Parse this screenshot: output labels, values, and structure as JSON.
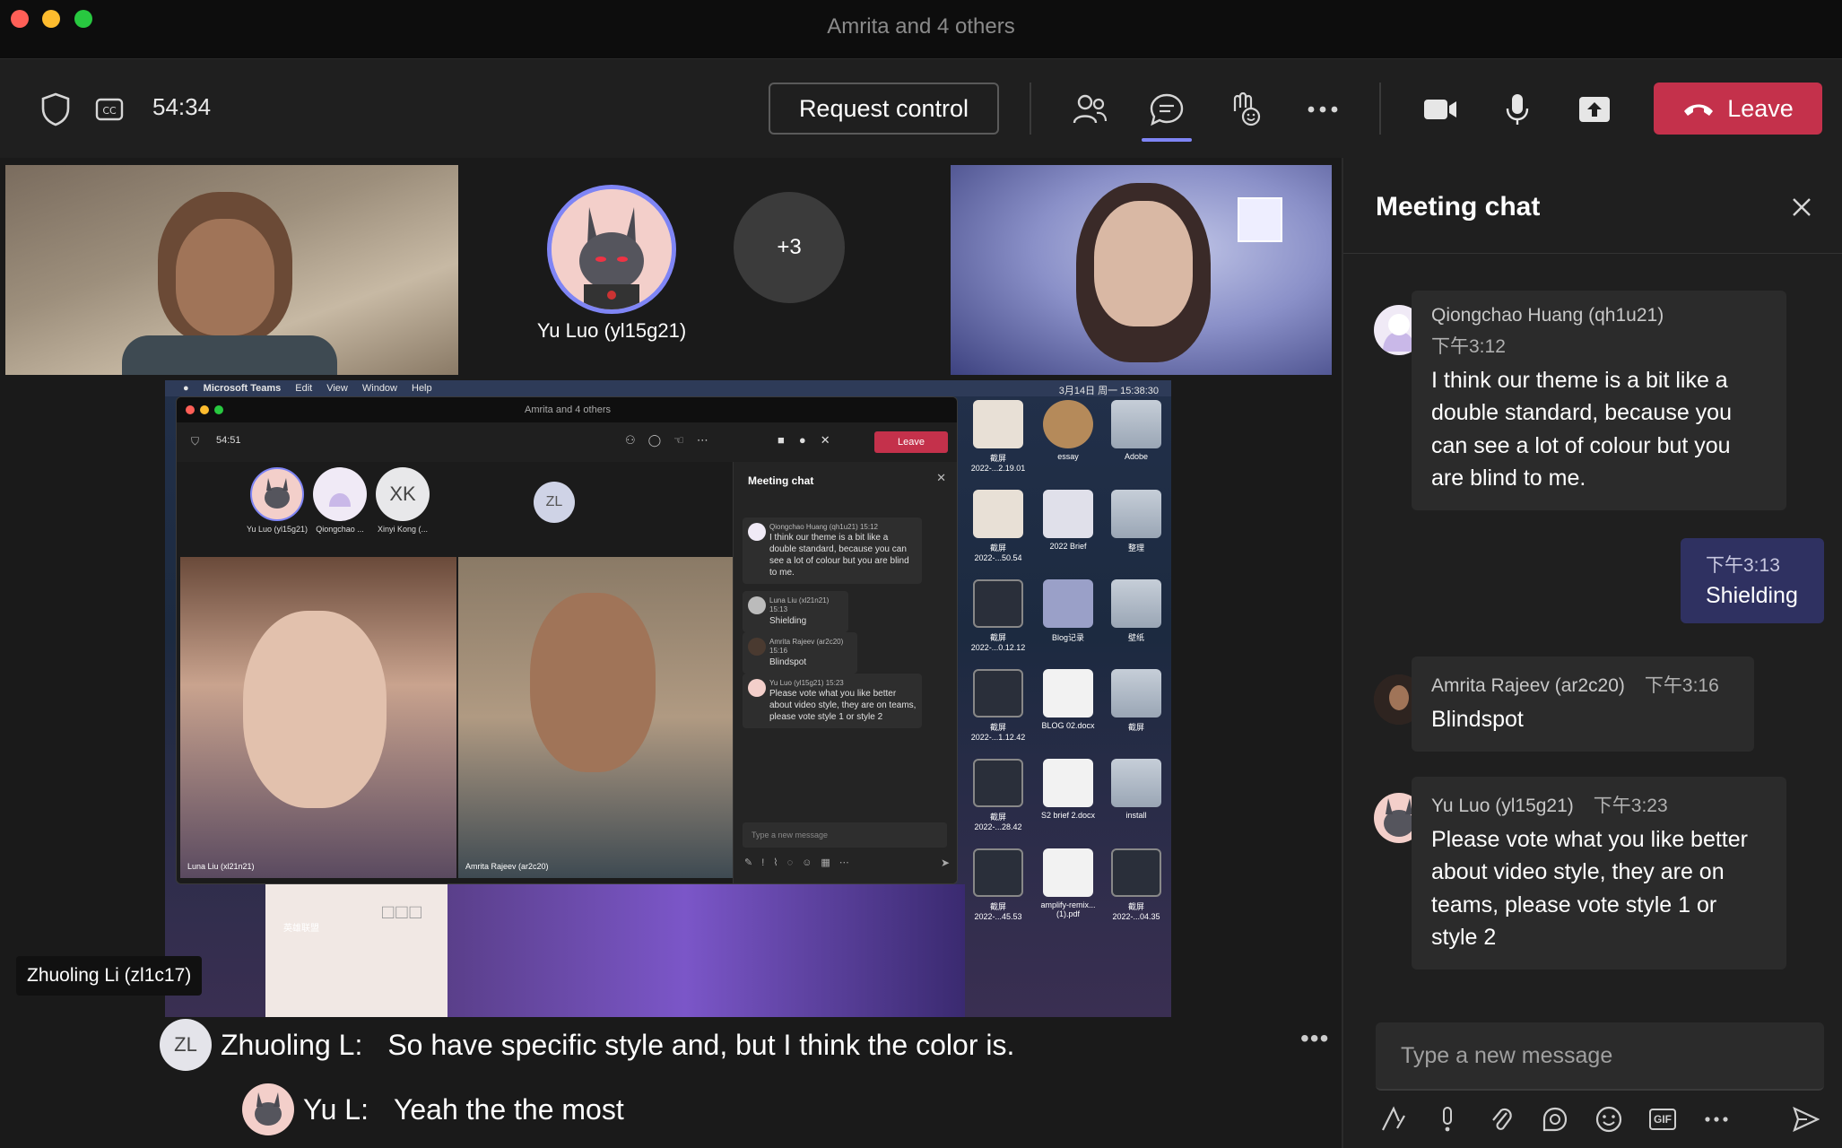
{
  "window": {
    "title": "Amrita and 4 others"
  },
  "toolbar": {
    "timer": "54:34",
    "request_control_label": "Request control",
    "leave_label": "Leave",
    "icons": [
      "shield-icon",
      "captions-icon",
      "people-icon",
      "chat-icon",
      "reactions-icon",
      "more-icon",
      "camera-icon",
      "mic-icon",
      "share-icon",
      "phone-icon"
    ]
  },
  "stage": {
    "avatar_name": "Yu Luo (yl15g21)",
    "overflow_count": "+3",
    "speaker_tag": "Zhuoling Li (zl1c17)"
  },
  "shared_screen": {
    "menubar": {
      "app": "Microsoft Teams",
      "items": [
        "Edit",
        "View",
        "Window",
        "Help"
      ],
      "clock": "3月14日 周一 15:38:30"
    },
    "window_title": "Amrita and 4 others",
    "timer": "54:51",
    "leave_label": "Leave",
    "participants": [
      {
        "name": "Yu Luo (yl15g21)"
      },
      {
        "name": "Qiongchao ..."
      },
      {
        "initials": "XK",
        "name": "Xinyi Kong (..."
      }
    ],
    "zl_initials": "ZL",
    "video_names": [
      "Luna Liu (xl21n21)",
      "Amrita Rajeev (ar2c20)"
    ],
    "chat_title": "Meeting chat",
    "chat": [
      {
        "name": "Qiongchao Huang (qh1u21)",
        "time": "15:12",
        "text": "I think our theme is a bit like a double standard, because you can see a lot of colour but you are blind to me."
      },
      {
        "name": "Luna Liu (xl21n21)",
        "time": "15:13",
        "text": "Shielding"
      },
      {
        "name": "Amrita Rajeev (ar2c20)",
        "time": "15:16",
        "text": "Blindspot"
      },
      {
        "name": "Yu Luo (yl15g21)",
        "time": "15:23",
        "text": "Please vote what you like better about video style, they are on teams, please vote style 1 or style 2"
      }
    ],
    "input_placeholder": "Type a new message",
    "desktop": [
      {
        "label": "截屏 2022-...2.19.01"
      },
      {
        "label": "essay"
      },
      {
        "label": "Adobe"
      },
      {
        "label": "截屏 2022-...50.54"
      },
      {
        "label": "2022 Brief"
      },
      {
        "label": "整理"
      },
      {
        "label": "截屏 2022-...0.12.12"
      },
      {
        "label": "Blog记录"
      },
      {
        "label": "壁纸"
      },
      {
        "label": "截屏 2022-...1.12.42"
      },
      {
        "label": "BLOG 02.docx"
      },
      {
        "label": "截屏"
      },
      {
        "label": "截屏 2022-...28.42"
      },
      {
        "label": "S2 brief 2.docx"
      },
      {
        "label": "install"
      },
      {
        "label": "截屏 2022-...45.53"
      },
      {
        "label": "amplify-remix...(1).pdf"
      },
      {
        "label": "截屏 2022-...04.35"
      }
    ],
    "game_label": "英雄联盟"
  },
  "captions": [
    {
      "initials": "ZL",
      "speaker": "Zhuoling L:",
      "text": "So have specific style and, but I think the color is."
    },
    {
      "speaker": "Yu L:",
      "text": "Yeah the the most"
    }
  ],
  "chat": {
    "title": "Meeting chat",
    "messages": [
      {
        "name": "Qiongchao Huang (qh1u21)",
        "time": "下午3:12",
        "text": "I think our theme is a bit like a double standard, because you can see a lot of colour but you are blind to me."
      },
      {
        "mine": true,
        "time": "下午3:13",
        "text": "Shielding"
      },
      {
        "name": "Amrita Rajeev (ar2c20)",
        "time": "下午3:16",
        "text": "Blindspot"
      },
      {
        "name": "Yu Luo (yl15g21)",
        "time": "下午3:23",
        "text": "Please vote what you like better about video style, they are on teams, please vote style 1 or style 2"
      }
    ],
    "input_placeholder": "Type a new message"
  },
  "colors": {
    "accent": "#7f85f5",
    "leave": "#c4314b",
    "background": "#1f1f1f"
  }
}
